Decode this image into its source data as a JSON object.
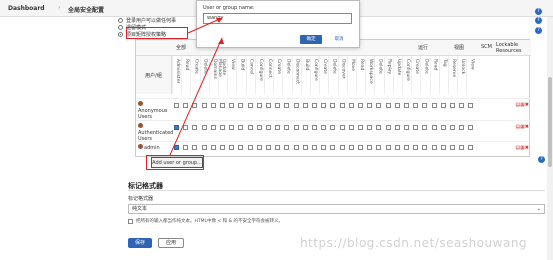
{
  "breadcrumb": {
    "home": "Dashboard",
    "separator": "›",
    "current": "全局安全配置"
  },
  "auth_options": [
    {
      "label": "登录用户可以做任何事",
      "checked": false
    },
    {
      "label": "遗留模式",
      "checked": false
    },
    {
      "label": "项目矩阵授权策略",
      "checked": true
    }
  ],
  "matrix": {
    "user_group_header": "用户/组",
    "groups": [
      "全部",
      "运行",
      "视图",
      "SCM",
      "Lockable Resources"
    ],
    "columns": [
      "Administer",
      "Read",
      "Create",
      "Delete",
      "Manage Domains",
      "Update",
      "View",
      "Build",
      "Cancel",
      "Configure",
      "Connect",
      "Create",
      "Delete",
      "Disconnect",
      "Build",
      "Configure",
      "Create",
      "Delete",
      "Discover",
      "Move",
      "Read",
      "Workspace",
      "Delete",
      "Replay",
      "Update",
      "Configure",
      "Create",
      "Delete",
      "Read",
      "Tag",
      "Reserve",
      "Unlock",
      "View"
    ],
    "users": [
      {
        "name": "Anonymous Users",
        "checked": []
      },
      {
        "name": "Authenticated Users",
        "checked": [
          0
        ]
      },
      {
        "name": "admin",
        "checked": [
          0
        ]
      }
    ]
  },
  "add_button_label": "Add user or group...",
  "dialog": {
    "title": "User or group name:",
    "value": "wangy",
    "ok": "确定",
    "cancel": "取消"
  },
  "markup": {
    "section_title": "标记格式器",
    "field_label": "标记格式器",
    "selected": "纯文本",
    "hint": "把所有的输入都当作纯文本。HTML中像 < 和 & 的不安全字符会被转义。"
  },
  "buttons": {
    "save": "保存",
    "apply": "应用"
  },
  "help_glyph": "?",
  "watermark": "https://blog.csdn.net/seashouwang",
  "colors": {
    "accent": "#2f63b4",
    "annotation": "#e02020"
  }
}
